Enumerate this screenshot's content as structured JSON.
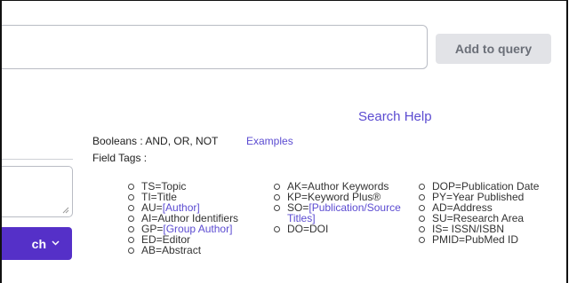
{
  "query": {
    "input_value": "",
    "add_to_query_label": "Add to query"
  },
  "help": {
    "search_help_label": "Search Help",
    "booleans_label": "Booleans : AND, OR, NOT",
    "examples_label": "Examples",
    "field_tags_label": "Field Tags :"
  },
  "left": {
    "search_button_label": "ch",
    "chevron_icon": "chevron-down-icon"
  },
  "colors": {
    "accent": "#5530c8",
    "link": "#5b4bd1",
    "disabled_button": "#e2e3e7"
  },
  "field_tags": {
    "col1": [
      {
        "pre": "TS=Topic",
        "link": "",
        "post": ""
      },
      {
        "pre": "TI=Title",
        "link": "",
        "post": ""
      },
      {
        "pre": "AU=",
        "link": "[Author]",
        "post": ""
      },
      {
        "pre": "AI=Author Identifiers",
        "link": "",
        "post": ""
      },
      {
        "pre": "GP=",
        "link": "[Group Author]",
        "post": ""
      },
      {
        "pre": "ED=Editor",
        "link": "",
        "post": ""
      },
      {
        "pre": "AB=Abstract",
        "link": "",
        "post": ""
      }
    ],
    "col2": [
      {
        "pre": "AK=Author Keywords",
        "link": "",
        "post": ""
      },
      {
        "pre": "KP=Keyword Plus®",
        "link": "",
        "post": ""
      },
      {
        "pre": "SO=",
        "link": "[Publication/Source Titles]",
        "post": ""
      },
      {
        "pre": "DO=DOI",
        "link": "",
        "post": ""
      }
    ],
    "col3": [
      {
        "pre": "DOP=Publication Date",
        "link": "",
        "post": ""
      },
      {
        "pre": "PY=Year Published",
        "link": "",
        "post": ""
      },
      {
        "pre": "AD=Address",
        "link": "",
        "post": ""
      },
      {
        "pre": "SU=Research Area",
        "link": "",
        "post": ""
      },
      {
        "pre": "IS= ISSN/ISBN",
        "link": "",
        "post": ""
      },
      {
        "pre": "PMID=PubMed ID",
        "link": "",
        "post": ""
      }
    ]
  }
}
